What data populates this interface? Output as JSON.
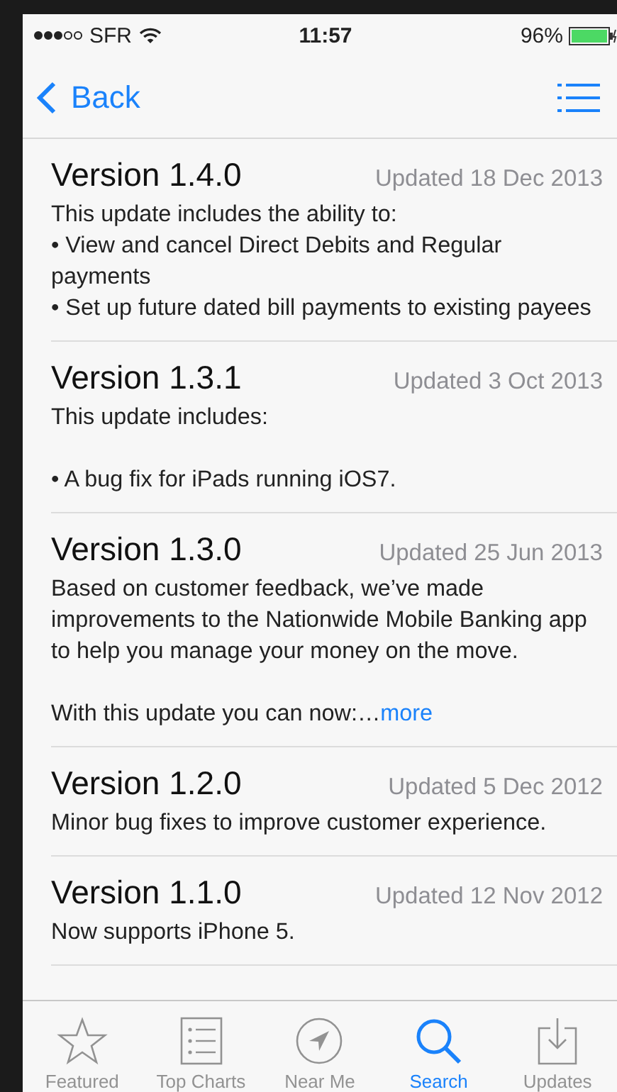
{
  "status_bar": {
    "carrier": "SFR",
    "signal_dots": [
      {
        "filled": true
      },
      {
        "filled": true
      },
      {
        "filled": true
      },
      {
        "filled": false
      },
      {
        "filled": false
      }
    ],
    "time": "11:57",
    "battery": "96%"
  },
  "nav": {
    "back": "Back"
  },
  "versions": [
    {
      "version": "Version 1.4.0",
      "date": "Updated 18 Dec 2013",
      "paragraphs": [
        [
          "This update includes the ability to:",
          "• View and cancel Direct Debits and Regular payments",
          "• Set up future dated bill payments to existing payees"
        ]
      ]
    },
    {
      "version": "Version 1.3.1",
      "date": "Updated 3 Oct 2013",
      "paragraphs": [
        [
          "This update includes:"
        ],
        [
          "• A bug fix for iPads running iOS7."
        ]
      ]
    },
    {
      "version": "Version 1.3.0",
      "date": "Updated 25 Jun 2013",
      "paragraphs": [
        [
          "Based on customer feedback, we’ve made improvements to the Nationwide Mobile Banking app to help you manage your money on the move."
        ],
        [
          "With this update you can now:…"
        ]
      ],
      "more": "more"
    },
    {
      "version": "Version 1.2.0",
      "date": "Updated 5 Dec 2012",
      "paragraphs": [
        [
          "Minor bug fixes to improve customer experience."
        ]
      ]
    },
    {
      "version": "Version 1.1.0",
      "date": "Updated 12 Nov 2012",
      "paragraphs": [
        [
          "Now supports iPhone 5."
        ]
      ]
    }
  ],
  "tabs": [
    {
      "label": "Featured",
      "kind": "star",
      "selected": false
    },
    {
      "label": "Top Charts",
      "kind": "list",
      "selected": false
    },
    {
      "label": "Near Me",
      "kind": "location",
      "selected": false
    },
    {
      "label": "Search",
      "kind": "search",
      "selected": true
    },
    {
      "label": "Updates",
      "kind": "download",
      "selected": false
    }
  ]
}
